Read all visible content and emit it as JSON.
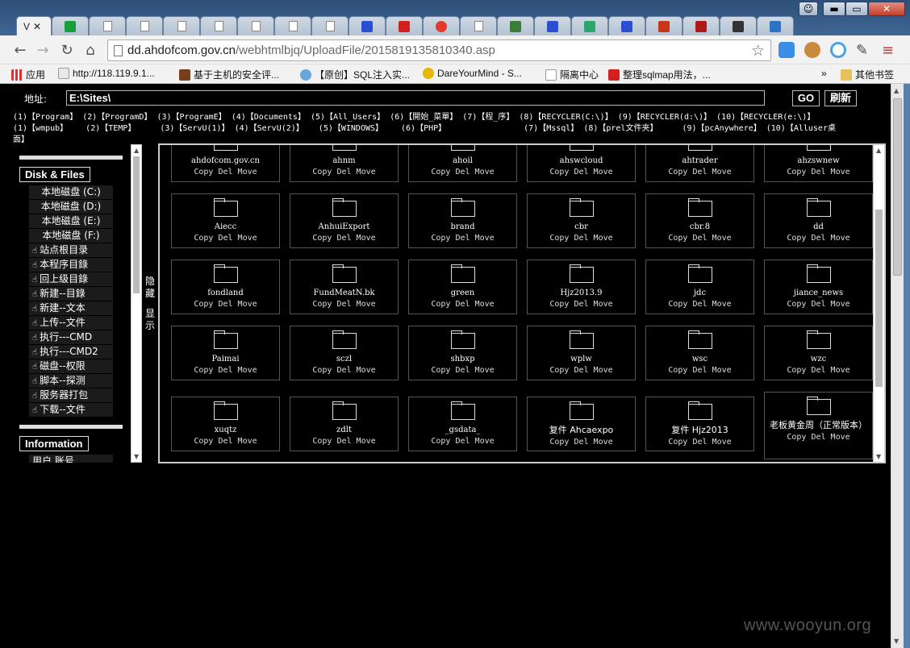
{
  "browser": {
    "active_tab_label": "V",
    "url_host": "dd.ahdofcom.gov.cn",
    "url_path": "/webhtmlbjq/UploadFile/2015819135810340.asp",
    "window_buttons": [
      "▬",
      "▭",
      "✕"
    ],
    "bookmarks": [
      {
        "label": "应用",
        "icon": "apps-grid-icon"
      },
      {
        "label": "http://118.119.9.1...",
        "icon": "page-icon"
      },
      {
        "label": "基于主机的安全评...",
        "icon": "site-icon"
      },
      {
        "label": "【原创】SQL注入实...",
        "icon": "snowflake-icon"
      },
      {
        "label": "DareYourMind - S...",
        "icon": "radiation-icon"
      },
      {
        "label": "隔离中心",
        "icon": "page-icon"
      },
      {
        "label": "整理sqlmap用法，...",
        "icon": "c-logo-icon"
      }
    ],
    "other_bookmarks": "其他书签",
    "overflow": "»"
  },
  "page": {
    "address_label": "地址:",
    "address_value": "E:\\Sites\\",
    "go_label": "GO",
    "refresh_label": "刷新",
    "paths_row1": [
      "(1)【Program】",
      "(2)【ProgramD】",
      "(3)【ProgramE】",
      "(4)【Documents】",
      "(5)【All_Users】",
      "(6)【開始_菜單】",
      "(7)【程_序】",
      "(8)【RECYCLER(C:\\)】",
      "(9)【RECYCLER(d:\\)】",
      "(10)【RECYCLER(e:\\)】"
    ],
    "paths_row2": [
      "(1)【wmpub】",
      "(2)【TEMP】",
      "(3)【ServU(1)】",
      "(4)【ServU(2)】",
      "(5)【WINDOWS】",
      "(6)【PHP】",
      "(7)【Mssql】",
      "(8)【prel文件夹】",
      "(9)【pcAnywhere】",
      "(10)【Alluser桌"
    ],
    "paths_row3": "面】",
    "toggle_hide": "隐藏",
    "toggle_show": "显示"
  },
  "sidebar": {
    "disk_heading": "Disk & Files",
    "disks": [
      "本地磁盘 (C:)",
      "本地磁盘 (D:)",
      "本地磁盘 (E:)",
      "本地磁盘 (F:)"
    ],
    "actions": [
      "站点根目录",
      "本程序目錄",
      "回上级目錄",
      "新建--目錄",
      "新建--文本",
      "上传--文件",
      "执行---CMD",
      "执行---CMD2",
      "磁盘--权限",
      "脚本--探测",
      "服务器打包",
      "下载--文件"
    ],
    "info_heading": "Information",
    "info_partial": "用户 账号"
  },
  "files": {
    "ops": "Copy Del Move",
    "row0": [
      "ahdofcom.gov.cn",
      "ahnm",
      "ahoil",
      "ahswcloud",
      "ahtrader",
      "ahzswnew"
    ],
    "row1": [
      "Aiecc",
      "AnhuiExport",
      "brand",
      "cbr",
      "cbr.8",
      "dd"
    ],
    "row2": [
      "fondland",
      "FundMeatN.bk",
      "green",
      "Hjz2013.9",
      "jdc",
      "jiance_news"
    ],
    "row3": [
      "Paimai",
      "sczl",
      "shbxp",
      "wplw",
      "wsc",
      "wzc"
    ],
    "row4": [
      "xuqtz",
      "zdlt",
      "_gsdata_",
      "复件 Ahcaexpo",
      "复件 Hjz2013",
      "老板黄金周（正常版本）"
    ]
  },
  "watermark": "www.wooyun.org"
}
